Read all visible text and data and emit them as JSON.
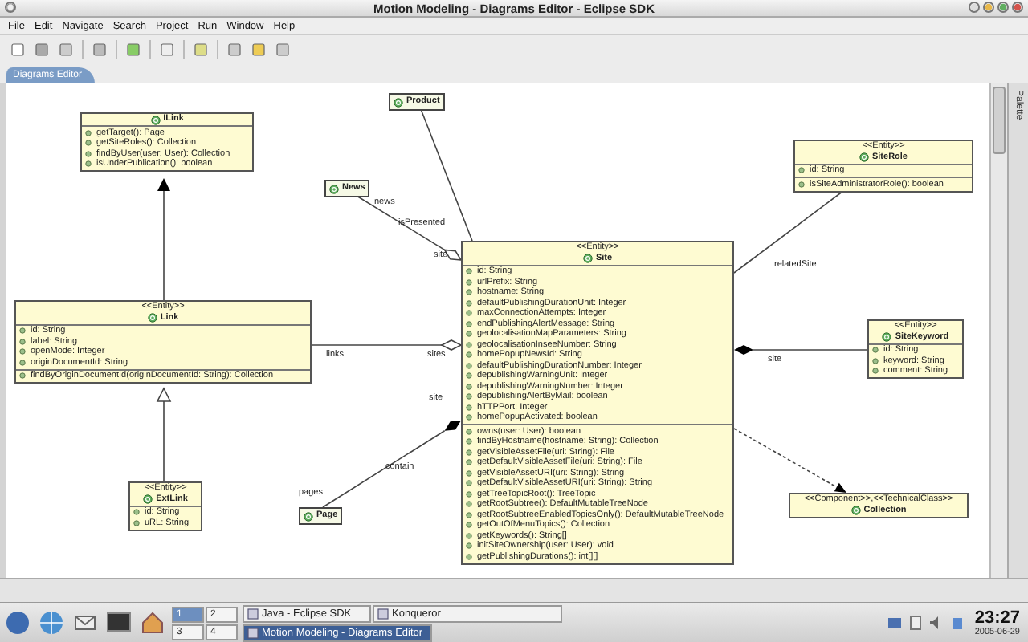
{
  "window": {
    "title": "Motion Modeling - Diagrams Editor - Eclipse SDK"
  },
  "menu": [
    "File",
    "Edit",
    "Navigate",
    "Search",
    "Project",
    "Run",
    "Window",
    "Help"
  ],
  "editor_tab": {
    "label": "Diagrams Editor",
    "selected": true
  },
  "palette": {
    "label": "Palette"
  },
  "diagram": {
    "classes": [
      {
        "kind": "interface",
        "name": "ILink",
        "operations": [
          "getTarget(): Page",
          "getSiteRoles(): Collection",
          "findByUser(user: User): Collection",
          "isUnderPublication(): boolean"
        ]
      },
      {
        "kind": "class",
        "stereotype": "<<Entity>>",
        "name": "Link",
        "attributes": [
          "id: String",
          "label: String",
          "openMode: Integer",
          "originDocumentId: String"
        ],
        "operations": [
          "findByOriginDocumentId(originDocumentId: String): Collection"
        ]
      },
      {
        "kind": "class",
        "stereotype": "<<Entity>>",
        "name": "ExtLink",
        "attributes": [
          "id: String",
          "uRL: String"
        ]
      },
      {
        "kind": "compact",
        "name": "Page"
      },
      {
        "kind": "compact",
        "name": "News"
      },
      {
        "kind": "compact",
        "name": "Product"
      },
      {
        "kind": "class",
        "stereotype": "<<Entity>>",
        "name": "Site",
        "attributes": [
          "id: String",
          "urlPrefix: String",
          "hostname: String",
          "defaultPublishingDurationUnit: Integer",
          "maxConnectionAttempts: Integer",
          "endPublishingAlertMessage: String",
          "geolocalisationMapParameters: String",
          "geolocalisationInseeNumber: String",
          "homePopupNewsId: String",
          "defaultPublishingDurationNumber: Integer",
          "depublishingWarningUnit: Integer",
          "depublishingWarningNumber: Integer",
          "depublishingAlertByMail: boolean",
          "hTTPPort: Integer",
          "homePopupActivated: boolean"
        ],
        "operations": [
          "owns(user: User): boolean",
          "findByHostname(hostname: String): Collection",
          "getVisibleAssetFile(uri: String): File",
          "getDefaultVisibleAssetFile(uri: String): File",
          "getVisibleAssetURI(uri: String): String",
          "getDefaultVisibleAssetURI(uri: String): String",
          "getTreeTopicRoot(): TreeTopic",
          "getRootSubtree(): DefaultMutableTreeNode",
          "getRootSubtreeEnabledTopicsOnly(): DefaultMutableTreeNode",
          "getOutOfMenuTopics(): Collection",
          "getKeywords(): String[]",
          "initSiteOwnership(user: User): void",
          "getPublishingDurations(): int[][]"
        ]
      },
      {
        "kind": "class",
        "stereotype": "<<Entity>>",
        "name": "SiteRole",
        "attributes": [
          "id: String"
        ],
        "operations": [
          "isSiteAdministratorRole(): boolean"
        ]
      },
      {
        "kind": "class",
        "stereotype": "<<Entity>>",
        "name": "SiteKeyword",
        "attributes": [
          "id: String",
          "keyword: String",
          "comment: String"
        ]
      },
      {
        "kind": "class",
        "stereotype": "<<Component>>,<<TechnicalClass>>",
        "name": "Collection"
      }
    ],
    "connectors": [
      {
        "kind": "association"
      },
      {
        "kind": "generalization"
      },
      {
        "kind": "association",
        "labels": [
          "relatedSite"
        ]
      },
      {
        "kind": "aggregation",
        "labels": [
          "news",
          "isPresented",
          "site"
        ]
      },
      {
        "kind": "aggregation",
        "labels": [
          "links",
          "sites"
        ]
      },
      {
        "kind": "composition",
        "labels": [
          "site"
        ]
      },
      {
        "kind": "realization"
      },
      {
        "kind": "composition",
        "labels": [
          "site",
          "contain",
          "pages"
        ]
      },
      {
        "kind": "dependency"
      }
    ]
  },
  "taskbar": {
    "pager": [
      {
        "label": "1",
        "selected": true
      },
      {
        "label": "2",
        "selected": false
      },
      {
        "label": "3",
        "selected": false
      },
      {
        "label": "4",
        "selected": false
      }
    ],
    "tasks": [
      {
        "label": "Java - Eclipse SDK",
        "selected": false
      },
      {
        "label": "Konqueror",
        "selected": false
      },
      {
        "label": "Motion Modeling - Diagrams Editor",
        "selected": true
      }
    ],
    "clock": {
      "time": "23:27",
      "date": "2005-06-29"
    }
  }
}
